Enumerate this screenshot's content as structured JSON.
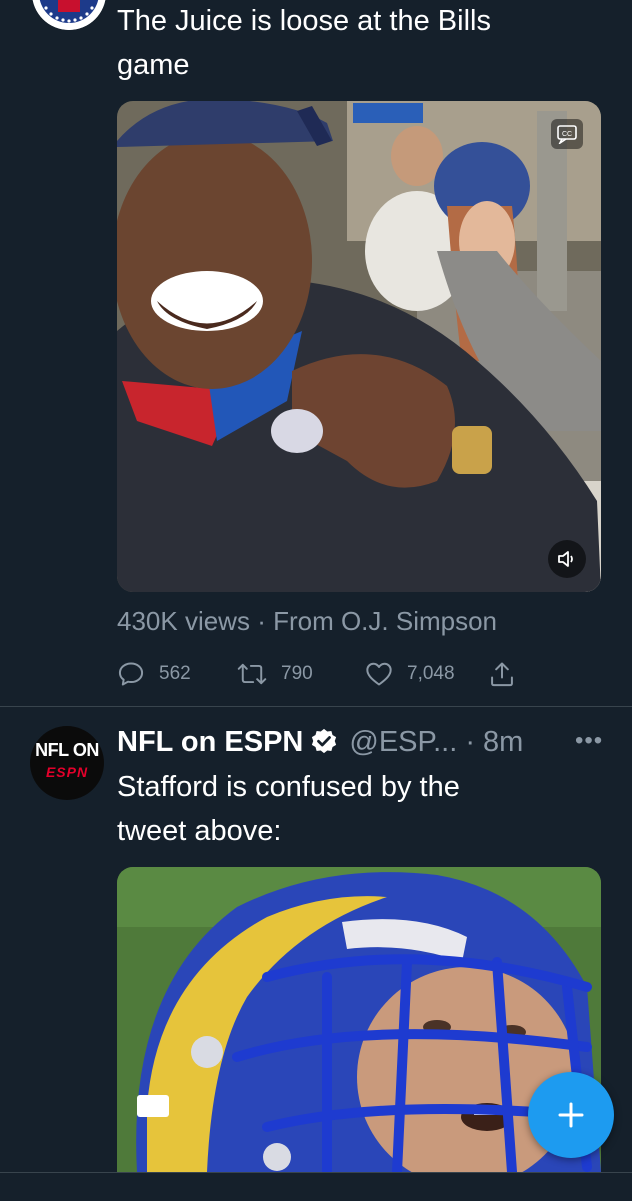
{
  "tweet1": {
    "text_line1": "The Juice is loose at the Bills",
    "text_line2": "game",
    "views": "430K views",
    "separator": " · ",
    "source": "From O.J. Simpson",
    "replies": "562",
    "retweets": "790",
    "likes": "7,048"
  },
  "tweet2": {
    "name": "NFL on ESPN",
    "handle": "@ESP... · 8m",
    "text_line1": "Stafford is confused by the",
    "text_line2": "tweet above:",
    "avatar_text_top": "NFL ON",
    "avatar_text_bottom": "ESPN"
  },
  "icons": {
    "reply": "reply-icon",
    "retweet": "retweet-icon",
    "like": "heart-icon",
    "share": "share-icon",
    "verified": "verified-badge-icon",
    "more": "more-icon",
    "compose": "plus-icon",
    "captions": "captions-icon",
    "volume": "volume-icon"
  },
  "colors": {
    "background": "#15202b",
    "text_secondary": "#8b98a5",
    "accent": "#1d9bf0",
    "divider": "#38444d"
  }
}
